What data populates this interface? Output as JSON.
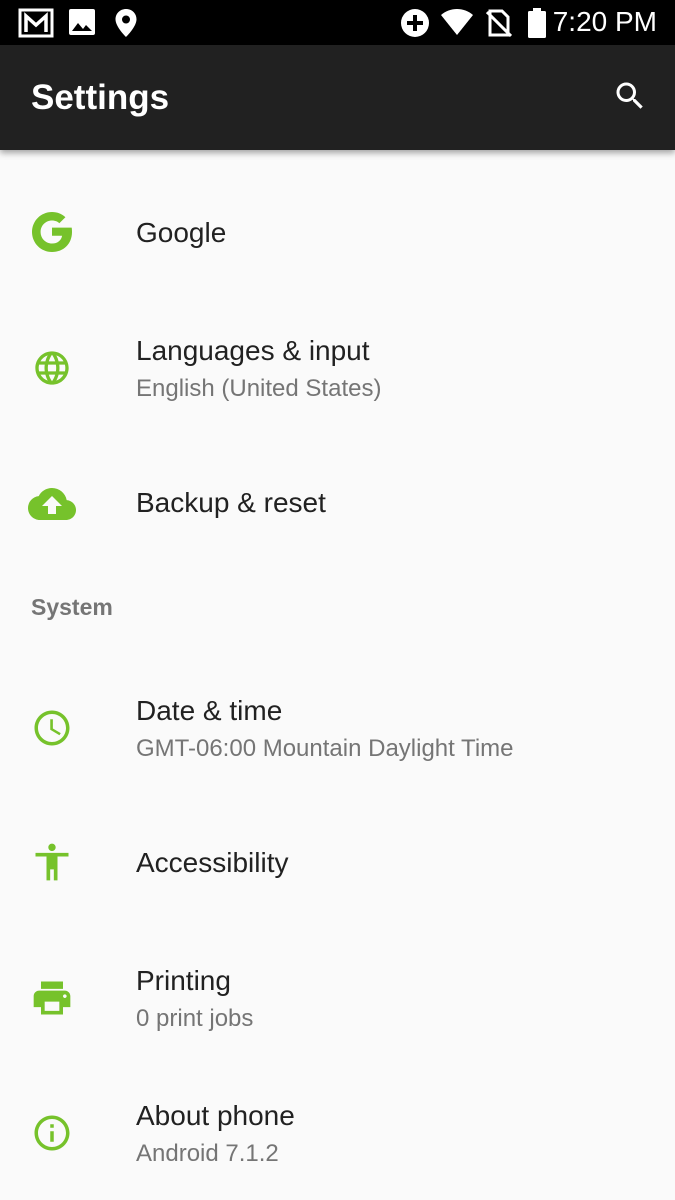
{
  "status_bar": {
    "time": "7:20 PM",
    "left_icons": [
      "gmail-icon",
      "image-icon",
      "location-pin-icon"
    ],
    "right_icons": [
      "data-saver-icon",
      "wifi-icon",
      "no-sim-icon",
      "battery-icon"
    ]
  },
  "app_bar": {
    "title": "Settings",
    "search_icon": "search-icon"
  },
  "items": [
    {
      "title": "Google",
      "summary": "",
      "icon": "google-icon"
    },
    {
      "title": "Languages & input",
      "summary": "English (United States)",
      "icon": "globe-icon"
    },
    {
      "title": "Backup & reset",
      "summary": "",
      "icon": "cloud-upload-icon"
    },
    {
      "title": "Date & time",
      "summary": "GMT-06:00 Mountain Daylight Time",
      "icon": "clock-icon"
    },
    {
      "title": "Accessibility",
      "summary": "",
      "icon": "accessibility-icon"
    },
    {
      "title": "Printing",
      "summary": "0 print jobs",
      "icon": "printer-icon"
    },
    {
      "title": "About phone",
      "summary": "Android 7.1.2",
      "icon": "info-icon"
    }
  ],
  "section_header": "System",
  "colors": {
    "accent": "#76c22b",
    "app_bar": "#212121",
    "status_bar": "#000000",
    "background": "#fafafa",
    "title_text": "#212121",
    "summary_text": "#757575"
  }
}
